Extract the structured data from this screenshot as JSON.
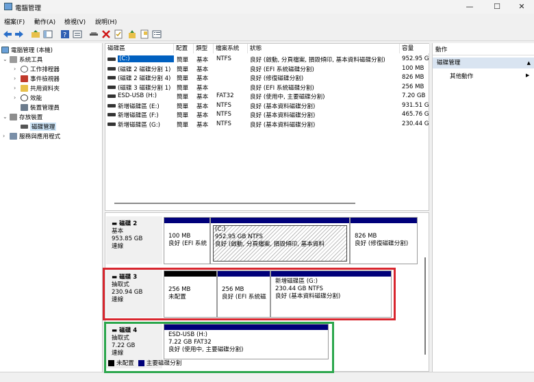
{
  "window": {
    "title": "電腦管理",
    "minimize_glyph": "—",
    "maximize_glyph": "☐",
    "close_glyph": "✕"
  },
  "menu": [
    "檔案(F)",
    "動作(A)",
    "檢視(V)",
    "說明(H)"
  ],
  "toolbar": {
    "icons": [
      "back-arrow-icon",
      "forward-arrow-icon",
      "up-folder-icon",
      "show-hide-tree-icon",
      "help-icon",
      "properties-icon",
      "connect-icon",
      "delete-icon",
      "checklist-icon",
      "import-icon",
      "export-icon",
      "list-icon"
    ]
  },
  "tree": {
    "items": [
      {
        "label": "電腦管理 (本機)",
        "level": 0,
        "expander": ""
      },
      {
        "label": "系統工具",
        "level": 1,
        "expander": "⌄"
      },
      {
        "label": "工作排程器",
        "level": 2,
        "expander": "›"
      },
      {
        "label": "事件檢視器",
        "level": 2,
        "expander": "›"
      },
      {
        "label": "共用資料夾",
        "level": 2,
        "expander": "›"
      },
      {
        "label": "效能",
        "level": 2,
        "expander": "›"
      },
      {
        "label": "裝置管理員",
        "level": 2,
        "expander": ""
      },
      {
        "label": "存放裝置",
        "level": 1,
        "expander": "⌄"
      },
      {
        "label": "磁碟管理",
        "level": 2,
        "expander": ""
      },
      {
        "label": "服務與應用程式",
        "level": 1,
        "expander": "›"
      }
    ]
  },
  "volume_list": {
    "columns": [
      "磁碟區",
      "配置",
      "類型",
      "檔案系統",
      "狀態",
      "容量"
    ],
    "rows": [
      [
        "(C:)",
        "簡單",
        "基本",
        "NTFS",
        "良好 (啟動, 分頁檔案, 損毀傾印, 基本資料磁碟分割)",
        "952.95 G"
      ],
      [
        "(磁碟 2 磁碟分割 1)",
        "簡單",
        "基本",
        "",
        "良好 (EFI 系統磁碟分割)",
        "100 MB"
      ],
      [
        "(磁碟 2 磁碟分割 4)",
        "簡單",
        "基本",
        "",
        "良好 (修復磁碟分割)",
        "826 MB"
      ],
      [
        "(磁碟 3 磁碟分割 1)",
        "簡單",
        "基本",
        "",
        "良好 (EFI 系統磁碟分割)",
        "256 MB"
      ],
      [
        "ESD-USB (H:)",
        "簡單",
        "基本",
        "FAT32",
        "良好 (使用中, 主要磁碟分割)",
        "7.20 GB"
      ],
      [
        "新增磁碟區 (E:)",
        "簡單",
        "基本",
        "NTFS",
        "良好 (基本資料磁碟分割)",
        "931.51 G"
      ],
      [
        "新增磁碟區 (F:)",
        "簡單",
        "基本",
        "NTFS",
        "良好 (基本資料磁碟分割)",
        "465.76 G"
      ],
      [
        "新增磁碟區 (G:)",
        "簡單",
        "基本",
        "NTFS",
        "良好 (基本資料磁碟分割)",
        "230.44 G"
      ]
    ]
  },
  "disks": [
    {
      "name": "磁碟 2",
      "type": "基本",
      "size": "953.85 GB",
      "status": "連線",
      "partitions": [
        {
          "title": "",
          "size": "100 MB",
          "status": "良好 (EFI 系統"
        },
        {
          "title": "(C:)",
          "size": "952.95 GB NTFS",
          "status": "良好 (啟動, 分頁檔案, 損毀傾印, 基本資料"
        },
        {
          "title": "",
          "size": "826 MB",
          "status": "良好 (修復磁碟分割)"
        }
      ]
    },
    {
      "name": "磁碟 3",
      "type": "抽取式",
      "size": "230.94 GB",
      "status": "連線",
      "partitions": [
        {
          "title": "",
          "size": "256 MB",
          "status": "未配置"
        },
        {
          "title": "",
          "size": "256 MB",
          "status": "良好 (EFI 系統磁"
        },
        {
          "title": "新增磁碟區  (G:)",
          "size": "230.44 GB NTFS",
          "status": "良好 (基本資料磁碟分割)"
        }
      ]
    },
    {
      "name": "磁碟 4",
      "type": "抽取式",
      "size": "7.22 GB",
      "status": "連線",
      "partitions": [
        {
          "title": "ESD-USB  (H:)",
          "size": "7.22 GB FAT32",
          "status": "良好 (使用中, 主要磁碟分割)"
        }
      ]
    }
  ],
  "legend": [
    {
      "label": "未配置",
      "color": "#000000"
    },
    {
      "label": "主要磁碟分割",
      "color": "#00007a"
    }
  ],
  "actions": {
    "header": "動作",
    "section": "磁碟管理",
    "section_arrow": "▲",
    "more": "其他動作",
    "more_arrow": "▶"
  },
  "highlights": {
    "disk3_color": "#d8262e",
    "disk4_color": "#2aa64b"
  }
}
